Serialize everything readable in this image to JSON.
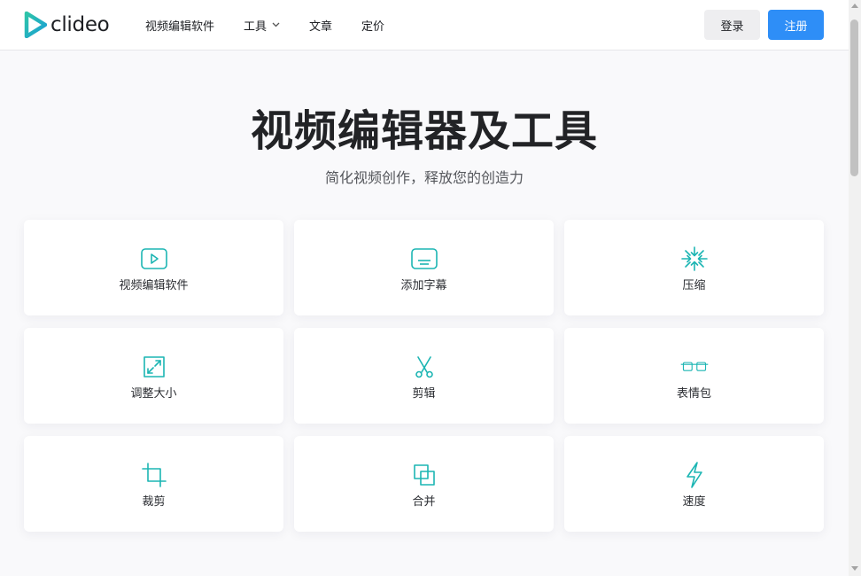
{
  "brand": {
    "name": "clideo",
    "accent": "#1cb5b3"
  },
  "nav": {
    "items": [
      {
        "label": "视频编辑软件"
      },
      {
        "label": "工具",
        "has_dropdown": true
      },
      {
        "label": "文章"
      },
      {
        "label": "定价"
      }
    ],
    "login_label": "登录",
    "signup_label": "注册",
    "signup_color": "#2e8ef7"
  },
  "hero": {
    "title": "视频编辑器及工具",
    "subtitle": "简化视频创作，释放您的创造力"
  },
  "tools": [
    {
      "label": "视频编辑软件",
      "icon": "video-play-icon"
    },
    {
      "label": "添加字幕",
      "icon": "subtitles-icon"
    },
    {
      "label": "压缩",
      "icon": "compress-icon"
    },
    {
      "label": "调整大小",
      "icon": "resize-icon"
    },
    {
      "label": "剪辑",
      "icon": "scissors-icon"
    },
    {
      "label": "表情包",
      "icon": "meme-glasses-icon"
    },
    {
      "label": "裁剪",
      "icon": "crop-icon"
    },
    {
      "label": "合并",
      "icon": "merge-icon"
    },
    {
      "label": "速度",
      "icon": "lightning-icon"
    }
  ]
}
